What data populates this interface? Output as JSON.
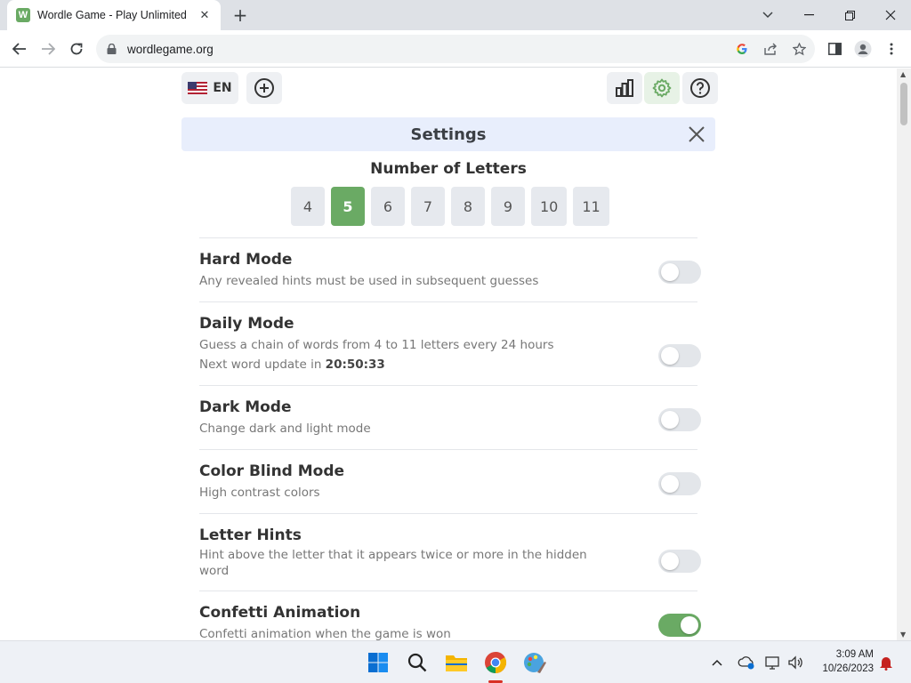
{
  "browser": {
    "tab_title": "Wordle Game - Play Unlimited",
    "favicon_letter": "W",
    "url": "wordlegame.org",
    "new_tab_symbol": "+"
  },
  "header": {
    "language": "EN"
  },
  "settings": {
    "title": "Settings",
    "letters_title": "Number of Letters",
    "letter_options": [
      "4",
      "5",
      "6",
      "7",
      "8",
      "9",
      "10",
      "11"
    ],
    "selected_letters": "5",
    "rows": [
      {
        "title": "Hard Mode",
        "desc": "Any revealed hints must be used in subsequent guesses",
        "on": false
      },
      {
        "title": "Daily Mode",
        "desc": "Guess a chain of words from 4 to 11 letters every 24 hours",
        "desc2_prefix": "Next word update in ",
        "desc2_time": "20:50:33",
        "on": false
      },
      {
        "title": "Dark Mode",
        "desc": "Change dark and light mode",
        "on": false
      },
      {
        "title": "Color Blind Mode",
        "desc": "High contrast colors",
        "on": false
      },
      {
        "title": "Letter Hints",
        "desc": "Hint above the letter that it appears twice or more in the hidden word",
        "on": false
      },
      {
        "title": "Confetti Animation",
        "desc": "Confetti animation when the game is won",
        "on": true
      }
    ]
  },
  "taskbar": {
    "time": "3:09 AM",
    "date": "10/26/2023"
  },
  "colors": {
    "accent_green": "#6aaa64",
    "settings_bar": "#e8eefc"
  }
}
